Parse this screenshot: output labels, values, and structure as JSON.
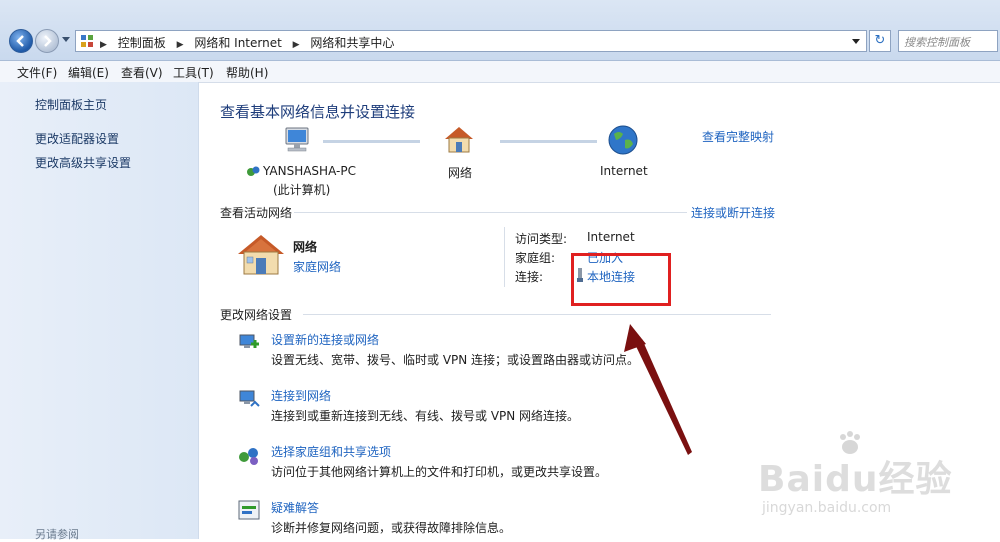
{
  "address": {
    "crumbs": [
      "控制面板",
      "网络和 Internet",
      "网络和共享中心"
    ],
    "search_placeholder": "搜索控制面板"
  },
  "menu": [
    "文件(F)",
    "编辑(E)",
    "查看(V)",
    "工具(T)",
    "帮助(H)"
  ],
  "sidebar": {
    "items": [
      "控制面板主页",
      "更改适配器设置",
      "更改高级共享设置"
    ],
    "see_also": "另请参阅"
  },
  "main": {
    "title": "查看基本网络信息并设置连接",
    "see_full_map": "查看完整映射",
    "map": {
      "computer_name": "YANSHASHA-PC",
      "computer_sub": "(此计算机)",
      "network": "网络",
      "internet": "Internet"
    },
    "active_networks": {
      "heading": "查看活动网络",
      "connect_link": "连接或断开连接",
      "network_name": "网络",
      "network_type": "家庭网络",
      "access_type_label": "访问类型:",
      "access_type_value": "Internet",
      "homegroup_label": "家庭组:",
      "homegroup_value": "已加入",
      "connection_label": "连接:",
      "connection_value": "本地连接"
    },
    "change_settings": {
      "heading": "更改网络设置",
      "tasks": [
        {
          "title": "设置新的连接或网络",
          "desc": "设置无线、宽带、拨号、临时或 VPN 连接；或设置路由器或访问点。"
        },
        {
          "title": "连接到网络",
          "desc": "连接到或重新连接到无线、有线、拨号或 VPN 网络连接。"
        },
        {
          "title": "选择家庭组和共享选项",
          "desc": "访问位于其他网络计算机上的文件和打印机，或更改共享设置。"
        },
        {
          "title": "疑难解答",
          "desc": "诊断并修复网络问题，或获得故障排除信息。"
        }
      ]
    }
  },
  "watermark": {
    "brand": "Baidu",
    "cn": "经验",
    "url": "jingyan.baidu.com"
  },
  "colors": {
    "link": "#1f64c0",
    "title": "#1e3d7b",
    "highlight": "#e02020",
    "arrow": "#7a1010"
  }
}
